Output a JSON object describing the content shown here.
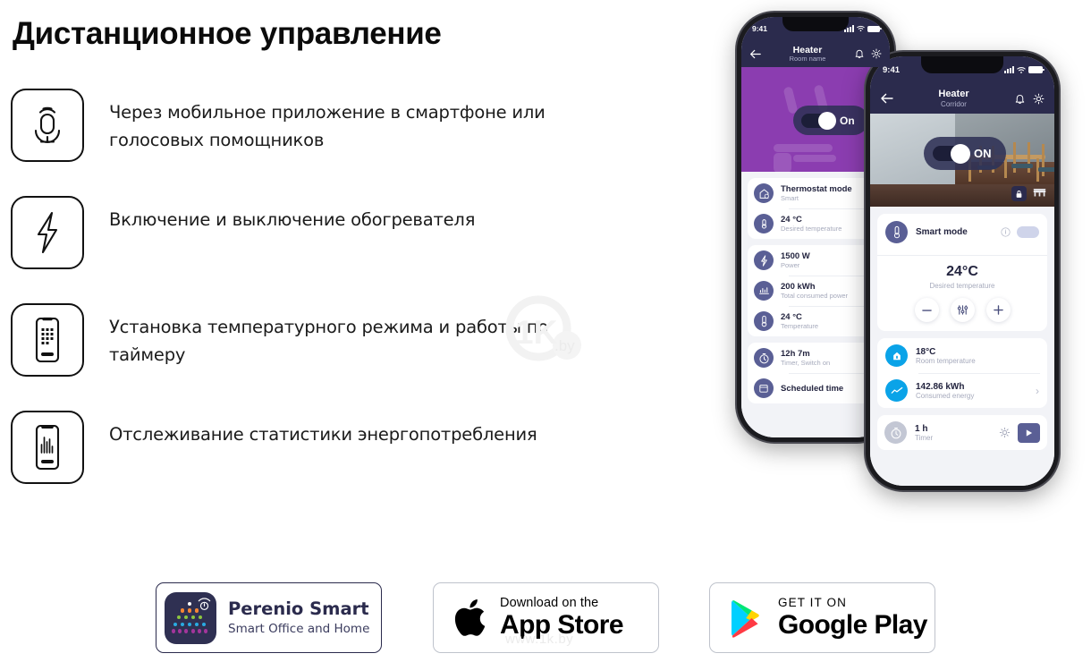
{
  "page": {
    "title": "Дистанционное управление",
    "watermark": "www.1k.by",
    "watermark_logo": "1K.by"
  },
  "features": [
    {
      "icon": "microphone-icon",
      "text": "Через мобильное приложение в смартфоне или голосовых помощников"
    },
    {
      "icon": "lightning-bolt-icon",
      "text": "Включение и выключение обогревателя"
    },
    {
      "icon": "phone-keypad-icon",
      "text": "Установка температурного режима и работы по таймеру"
    },
    {
      "icon": "phone-statistics-icon",
      "text": "Отслеживание статистики энергопотребления"
    }
  ],
  "phone_back": {
    "statusbar": {
      "time": "9:41",
      "signal_icon": "signal-bars-icon",
      "wifi_icon": "wifi-icon",
      "battery_icon": "battery-icon"
    },
    "nav": {
      "back_icon": "arrow-left-icon",
      "title": "Heater",
      "subtitle": "Room name",
      "bell_icon": "bell-icon",
      "gear_icon": "gear-icon"
    },
    "hero": {
      "toggle_label": "On",
      "accent_color": "#8b3db0"
    },
    "cards": [
      {
        "rows": [
          {
            "icon": "thermostat-house-icon",
            "value": "Thermostat mode",
            "label": "Smart"
          },
          {
            "icon": "thermometer-gear-icon",
            "value": "24 °C",
            "label": "Desired temperature"
          }
        ]
      },
      {
        "rows": [
          {
            "icon": "power-bolt-icon",
            "value": "1500 W",
            "label": "Power"
          },
          {
            "icon": "energy-chart-icon",
            "value": "200 kWh",
            "label": "Total consumed power"
          },
          {
            "icon": "thermometer-icon",
            "value": "24 °C",
            "label": "Temperature"
          }
        ]
      },
      {
        "rows": [
          {
            "icon": "stopwatch-icon",
            "value": "12h 7m",
            "label": "Timer, Switch on"
          },
          {
            "icon": "calendar-icon",
            "value": "Scheduled time",
            "label": ""
          }
        ]
      }
    ]
  },
  "phone_front": {
    "statusbar": {
      "time": "9:41",
      "signal_icon": "signal-bars-icon",
      "wifi_icon": "wifi-icon",
      "battery_icon": "battery-icon"
    },
    "nav": {
      "back_icon": "arrow-left-icon",
      "title": "Heater",
      "subtitle": "Corridor",
      "bell_icon": "bell-icon",
      "gear_icon": "gear-icon"
    },
    "hero": {
      "toggle_label": "ON",
      "lock_icon": "lock-icon",
      "furniture_icon": "furniture-icon"
    },
    "smart_mode": {
      "icon": "thermometer-icon",
      "label": "Smart mode",
      "info_icon": "info-icon",
      "toggle_state": "on"
    },
    "temperature": {
      "value": "24°C",
      "label": "Desired temperature",
      "minus_icon": "minus-icon",
      "sliders_icon": "sliders-icon",
      "plus_icon": "plus-icon"
    },
    "stats": [
      {
        "icon": "home-temp-icon",
        "value": "18°C",
        "label": "Room temperature",
        "chevron": ""
      },
      {
        "icon": "energy-line-icon",
        "value": "142.86 kWh",
        "label": "Consumed energy",
        "chevron": "›"
      }
    ],
    "timer": {
      "icon": "stopwatch-icon",
      "value": "1 h",
      "label": "Timer",
      "gear_icon": "gear-icon",
      "play_icon": "play-icon"
    }
  },
  "badges": {
    "perenio": {
      "logo_icon": "perenio-dots-logo",
      "wifi_power_icon": "wifi-power-icon",
      "title": "Perenio Smart",
      "subtitle": "Smart Office and Home",
      "dot_colors": [
        "#ffffff",
        "#f58634",
        "#8cc63f",
        "#29abe2",
        "#a3359b"
      ]
    },
    "appstore": {
      "icon": "apple-logo-icon",
      "line1": "Download on the",
      "line2": "App Store"
    },
    "googleplay": {
      "icon": "google-play-triangle-icon",
      "line1": "GET IT ON",
      "line2": "Google Play"
    }
  }
}
